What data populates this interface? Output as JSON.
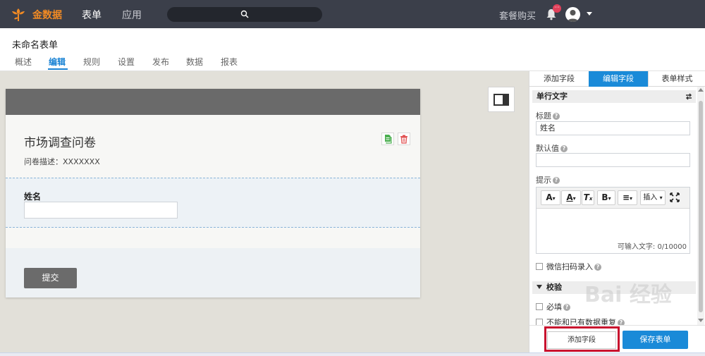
{
  "topbar": {
    "brand": "金数据",
    "nav": [
      "表单",
      "应用"
    ],
    "package_link": "套餐购买",
    "notification_badge": "···"
  },
  "header": {
    "form_name": "未命名表单",
    "tabs": [
      "概述",
      "编辑",
      "规则",
      "设置",
      "发布",
      "数据",
      "报表"
    ],
    "active_tab": "编辑"
  },
  "form": {
    "title": "市场调查问卷",
    "description": "问卷描述：XXXXXXX",
    "field_label": "姓名",
    "submit_label": "提交"
  },
  "panel": {
    "tabs": [
      "添加字段",
      "编辑字段",
      "表单样式"
    ],
    "active_tab": "编辑字段",
    "section_title": "单行文字",
    "title_label": "标题",
    "title_value": "姓名",
    "default_label": "默认值",
    "default_value": "",
    "hint_label": "提示",
    "toolbar": {
      "font": "A",
      "color": "A",
      "clear": "T",
      "bold": "B",
      "align": "≡",
      "insert": "插入"
    },
    "char_count": "可输入文字: 0/10000",
    "wechat_scan": "微信扫码录入",
    "validation_title": "校验",
    "required": "必填",
    "no_duplicate": "不能和已有数据重复",
    "watermark": "Bai 经验",
    "add_field_button": "添加字段",
    "save_button": "保存表单"
  },
  "colors": {
    "brand_orange": "#f08a24",
    "accent_blue": "#1a8ad8",
    "highlight_red": "#c8102e",
    "topbar_bg": "#3b3f4a"
  }
}
